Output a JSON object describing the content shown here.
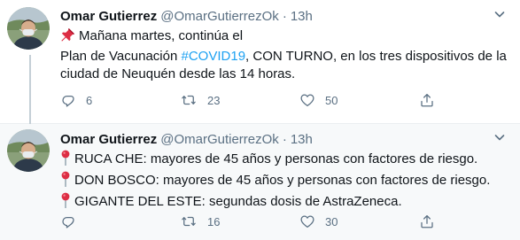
{
  "thread": [
    {
      "author": {
        "name": "Omar Gutierrez",
        "handle": "@OmarGutierrezOk",
        "time": "13h"
      },
      "lines": {
        "l1": "Mañana martes, continúa el",
        "l2_pre": "Plan de Vacunación ",
        "l2_tag": "#COVID19",
        "l2_post": ", CON TURNO, en los tres dispositivos de la",
        "l3": "ciudad de Neuquén desde las 14 horas."
      },
      "counts": {
        "replies": "6",
        "retweets": "23",
        "likes": "50"
      }
    },
    {
      "author": {
        "name": "Omar Gutierrez",
        "handle": "@OmarGutierrezOk",
        "time": "13h"
      },
      "lines": {
        "l1": "RUCA CHE: mayores de 45 años y personas con factores de riesgo.",
        "l2": "DON BOSCO: mayores de 45 años y personas con factores de riesgo.",
        "l3": "GIGANTE DEL ESTE: segundas dosis de AstraZeneca."
      },
      "counts": {
        "replies": "",
        "retweets": "16",
        "likes": "30"
      }
    }
  ],
  "icons": {
    "pushpin": "pushpin-icon",
    "round_pin": "round-pushpin-icon",
    "reply": "reply-icon",
    "retweet": "retweet-icon",
    "like": "heart-icon",
    "share": "share-icon",
    "more": "chevron-down-icon"
  },
  "colors": {
    "link": "#1da1f2",
    "muted": "#5b7083",
    "thread_line": "#c4cfd6",
    "pin_red": "#dd2e44"
  }
}
